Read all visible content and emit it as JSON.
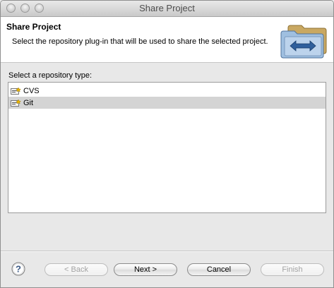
{
  "window": {
    "title": "Share Project"
  },
  "header": {
    "title": "Share Project",
    "description": "Select the repository plug-in that will be used to share the selected project."
  },
  "repository_list": {
    "label": "Select a repository type:",
    "items": [
      {
        "label": "CVS",
        "selected": false,
        "icon": "cvs-repository-icon"
      },
      {
        "label": "Git",
        "selected": true,
        "icon": "git-repository-icon"
      }
    ]
  },
  "buttons": {
    "help_icon": "help-icon",
    "back": "< Back",
    "next": "Next >",
    "cancel": "Cancel",
    "finish": "Finish"
  },
  "colors": {
    "selection": "#d4d4d4",
    "header_background": "#ffffff",
    "dialog_background": "#e8e8e8"
  }
}
